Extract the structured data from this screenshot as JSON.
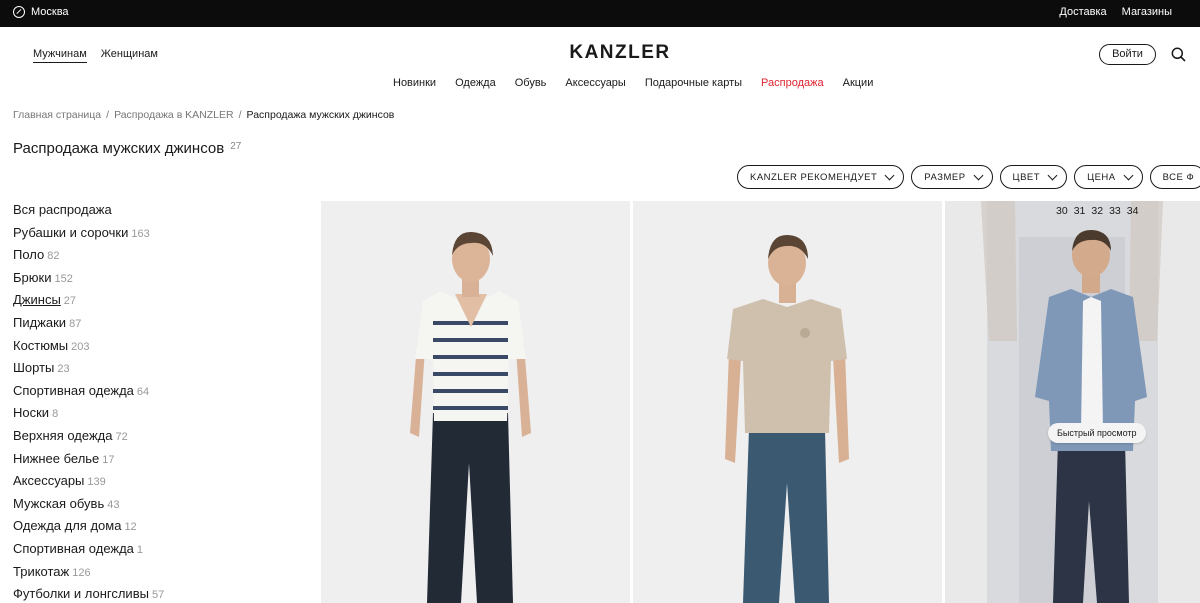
{
  "topbar": {
    "city": "Москва",
    "links": [
      "Доставка",
      "Магазины"
    ]
  },
  "header": {
    "gender_tabs": [
      "Мужчинам",
      "Женщинам"
    ],
    "logo": "KANZLER",
    "login": "Войти",
    "menu": [
      "Новинки",
      "Одежда",
      "Обувь",
      "Аксессуары",
      "Подарочные карты",
      "Распродажа",
      "Акции"
    ]
  },
  "breadcrumb": [
    "Главная страница",
    "/",
    "Распродажа в KANZLER",
    "/",
    "Распродажа мужских джинсов"
  ],
  "page": {
    "title": "Распродажа мужских джинсов",
    "count": "27"
  },
  "filters": [
    "KANZLER РЕКОМЕНДУЕТ",
    "РАЗМЕР",
    "ЦВЕТ",
    "ЦЕНА",
    "ВСЕ Ф"
  ],
  "sidebar": [
    {
      "label": "Вся распродажа",
      "count": ""
    },
    {
      "label": "Рубашки и сорочки",
      "count": "163"
    },
    {
      "label": "Поло",
      "count": "82"
    },
    {
      "label": "Брюки",
      "count": "152"
    },
    {
      "label": "Джинсы",
      "count": "27"
    },
    {
      "label": "Пиджаки",
      "count": "87"
    },
    {
      "label": "Костюмы",
      "count": "203"
    },
    {
      "label": "Шорты",
      "count": "23"
    },
    {
      "label": "Спортивная одежда",
      "count": "64"
    },
    {
      "label": "Носки",
      "count": "8"
    },
    {
      "label": "Верхняя одежда",
      "count": "72"
    },
    {
      "label": "Нижнее белье",
      "count": "17"
    },
    {
      "label": "Аксессуары",
      "count": "139"
    },
    {
      "label": "Мужская обувь",
      "count": "43"
    },
    {
      "label": "Одежда для дома",
      "count": "12"
    },
    {
      "label": "Спортивная одежда",
      "count": "1"
    },
    {
      "label": "Трикотаж",
      "count": "126"
    },
    {
      "label": "Футболки и лонгсливы",
      "count": "57"
    }
  ],
  "products": {
    "sizes": [
      "30",
      "31",
      "32",
      "33",
      "34"
    ],
    "quick_view": "Быстрый просмотр"
  },
  "colors": {
    "sale": "#e02430",
    "topbar": "#0c0c0c"
  }
}
